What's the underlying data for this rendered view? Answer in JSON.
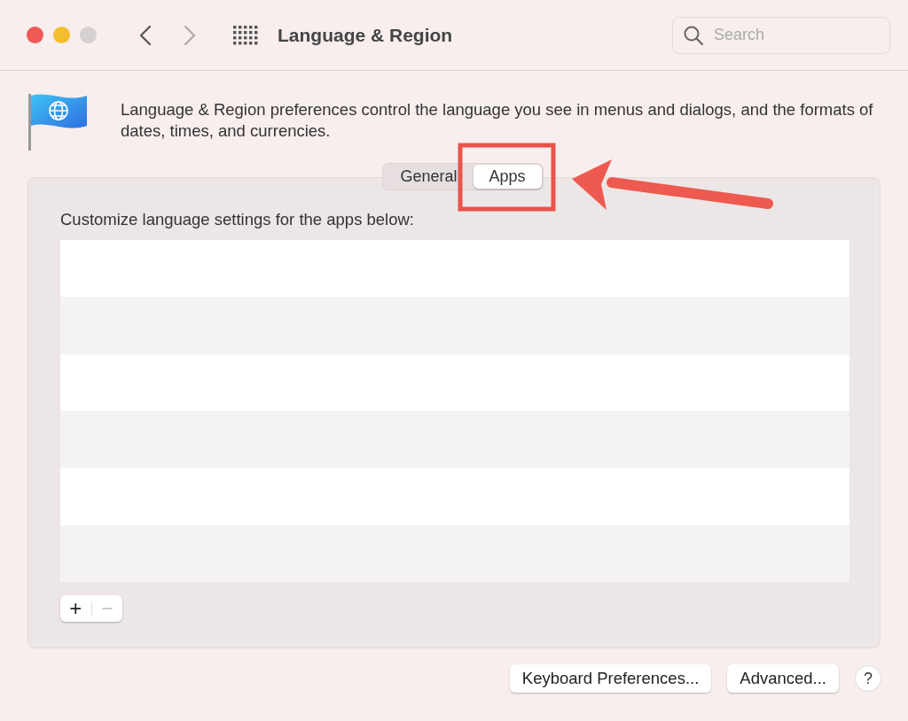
{
  "window": {
    "title": "Language & Region",
    "back_enabled": true,
    "forward_enabled": false
  },
  "search": {
    "placeholder": "Search"
  },
  "description": "Language & Region preferences control the language you see in menus and dialogs, and the formats of dates, times, and currencies.",
  "tabs": [
    {
      "label": "General",
      "selected": false
    },
    {
      "label": "Apps",
      "selected": true
    }
  ],
  "apps_panel": {
    "caption": "Customize language settings for the apps below:",
    "add_button": "+",
    "remove_button": "−",
    "remove_disabled": true
  },
  "buttons": [
    {
      "label": "Keyboard Preferences..."
    },
    {
      "label": "Advanced..."
    }
  ],
  "help": "?"
}
